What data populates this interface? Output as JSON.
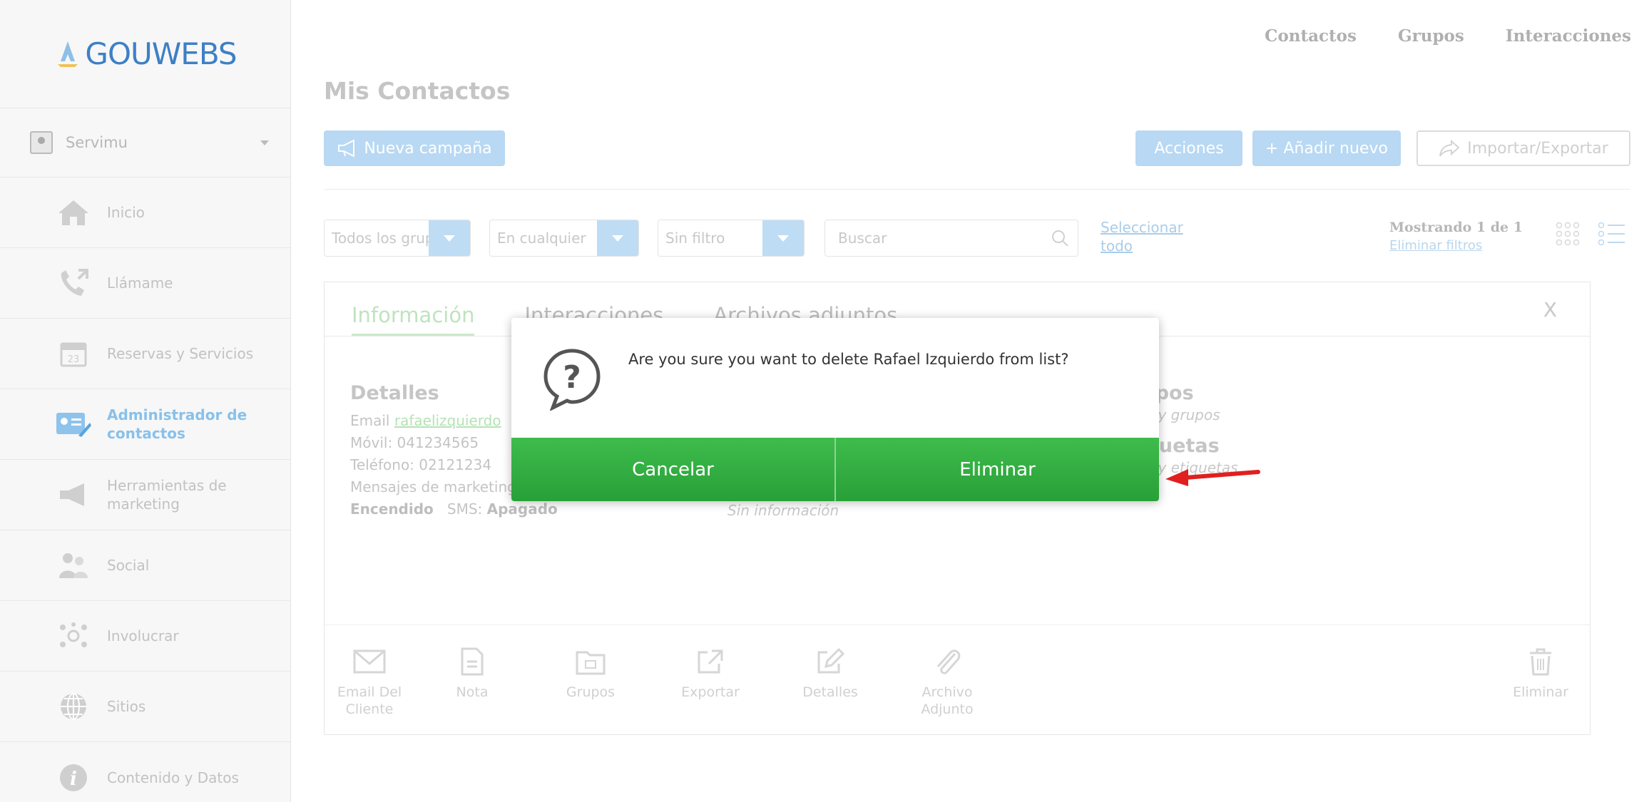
{
  "brand": {
    "name": "GOUWEBS"
  },
  "topnav": {
    "items": [
      "Contactos",
      "Grupos",
      "Interacciones"
    ]
  },
  "sidebar": {
    "account": "Servimu",
    "items": [
      {
        "label": "Inicio"
      },
      {
        "label": "Llámame"
      },
      {
        "label": "Reservas y Servicios"
      },
      {
        "label": "Administrador de contactos"
      },
      {
        "label": "Herramientas de marketing"
      },
      {
        "label": "Social"
      },
      {
        "label": "Involucrar"
      },
      {
        "label": "Sitios"
      },
      {
        "label": "Contenido y Datos"
      }
    ]
  },
  "page": {
    "title": "Mis Contactos"
  },
  "toolbar": {
    "campaign": "Nueva campaña",
    "actions": "Acciones",
    "add": "+ Añadir nuevo",
    "import_export": "Importar/Exportar"
  },
  "filters": {
    "groups": "Todos los grupos",
    "when": "En cualquier",
    "filter": "Sin filtro",
    "search_placeholder": "Buscar",
    "select_all": "Seleccionar todo",
    "showing": "Mostrando 1 de 1",
    "clear_filters": "Eliminar filtros"
  },
  "card": {
    "tabs": [
      "Información",
      "Interacciones",
      "Archivos adjuntos"
    ],
    "close": "X",
    "details": {
      "heading": "Detalles",
      "email_label": "Email",
      "email_value": "rafaelizquierdo",
      "mobile": "Móvil: 041234565",
      "phone": "Teléfono: 02121234",
      "marketing": "Mensajes de marketing: Email del cliente:",
      "email_state": "Encendido",
      "sms_label": "SMS:",
      "sms_state": "Apagado"
    },
    "no_info": "Sin información",
    "groups": {
      "heading": "Grupos",
      "empty": "No hay grupos",
      "tags_heading": "Etiquetas",
      "tags_empty": "No hay etiquetas"
    },
    "actions": [
      "Email Del Cliente",
      "Nota",
      "Grupos",
      "Exportar",
      "Detalles",
      "Archivo Adjunto"
    ],
    "delete": "Eliminar"
  },
  "modal": {
    "message": "Are you sure you want to delete Rafael Izquierdo from list?",
    "cancel": "Cancelar",
    "confirm": "Eliminar"
  },
  "colors": {
    "accent_blue": "#3d80c5",
    "confirm_green": "#2fae40",
    "arrow_red": "#e0201e"
  }
}
